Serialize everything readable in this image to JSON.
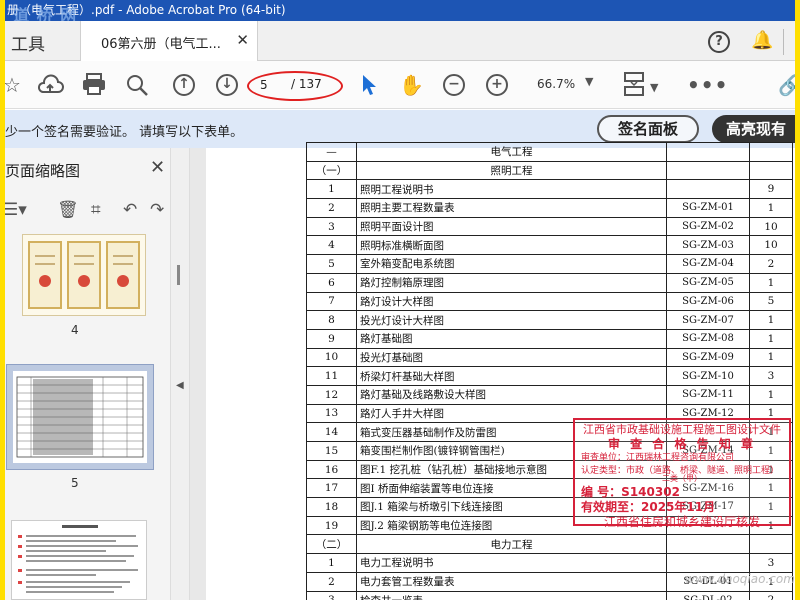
{
  "window": {
    "title": "册（电气工程）.pdf - Adobe Acrobat Pro (64-bit)",
    "watermark": "道 桥 网"
  },
  "tabbar": {
    "tools_label": "工具",
    "doc_tab_label": "06第六册（电气工...",
    "close_glyph": "✕"
  },
  "toolbar": {
    "current_page": "5",
    "total_pages": "/ 137",
    "zoom": "66.7%"
  },
  "signbar": {
    "message": "少一个签名需要验证。 请填写以下表单。",
    "sign_panel_label": "签名面板",
    "highlight_label": "高亮现有"
  },
  "leftpanel": {
    "title": "页面缩略图",
    "thumbnails": [
      {
        "label": "4"
      },
      {
        "label": "5"
      }
    ]
  },
  "document": {
    "header_partial": "电气工程",
    "sections": [
      {
        "marker": "（一）",
        "name": "照明工程",
        "rows": [
          {
            "no": "1",
            "name": "照明工程说明书",
            "code": "",
            "count": "9"
          },
          {
            "no": "2",
            "name": "照明主要工程数量表",
            "code": "SG-ZM-01",
            "count": "1"
          },
          {
            "no": "3",
            "name": "照明平面设计图",
            "code": "SG-ZM-02",
            "count": "10"
          },
          {
            "no": "4",
            "name": "照明标准横断面图",
            "code": "SG-ZM-03",
            "count": "10"
          },
          {
            "no": "5",
            "name": "室外箱变配电系统图",
            "code": "SG-ZM-04",
            "count": "2"
          },
          {
            "no": "6",
            "name": "路灯控制箱原理图",
            "code": "SG-ZM-05",
            "count": "1"
          },
          {
            "no": "7",
            "name": "路灯设计大样图",
            "code": "SG-ZM-06",
            "count": "5"
          },
          {
            "no": "8",
            "name": "投光灯设计大样图",
            "code": "SG-ZM-07",
            "count": "1"
          },
          {
            "no": "9",
            "name": "路灯基础图",
            "code": "SG-ZM-08",
            "count": "1"
          },
          {
            "no": "10",
            "name": "投光灯基础图",
            "code": "SG-ZM-09",
            "count": "1"
          },
          {
            "no": "11",
            "name": "桥梁灯杆基础大样图",
            "code": "SG-ZM-10",
            "count": "3"
          },
          {
            "no": "12",
            "name": "路灯基础及线路敷设大样图",
            "code": "SG-ZM-11",
            "count": "1"
          },
          {
            "no": "13",
            "name": "路灯人手井大样图",
            "code": "SG-ZM-12",
            "count": "1"
          },
          {
            "no": "14",
            "name": "箱式变压器基础制作及防雷图",
            "code": "",
            "count": "1"
          },
          {
            "no": "15",
            "name": "箱变围栏制作图(镀锌钢管围栏)",
            "code": "SG-ZM-14",
            "count": "1"
          },
          {
            "no": "16",
            "name": "图F.1 挖孔桩（钻孔桩）基础接地示意图",
            "code": "",
            "count": "1"
          },
          {
            "no": "17",
            "name": "图I 桥面伸缩装置等电位连接",
            "code": "SG-ZM-16",
            "count": "1"
          },
          {
            "no": "18",
            "name": "图J.1 箱梁与桥墩引下线连接图",
            "code": "SG-ZM-17",
            "count": "1"
          },
          {
            "no": "19",
            "name": "图J.2 箱梁钢筋等电位连接图",
            "code": "",
            "count": "1"
          }
        ]
      },
      {
        "marker": "（二）",
        "name": "电力工程",
        "rows": [
          {
            "no": "1",
            "name": "电力工程说明书",
            "code": "",
            "count": "3"
          },
          {
            "no": "2",
            "name": "电力套管工程数量表",
            "code": "SG-DL-01",
            "count": "1"
          },
          {
            "no": "3",
            "name": "检查井一览表",
            "code": "SG-DL-02",
            "count": "2"
          }
        ]
      }
    ],
    "stamp": {
      "line1": "江西省市政基础设施工程施工图设计文件",
      "line2": "审 查 合 格 告 知 章",
      "line3": "审查单位：江西瑞林工程咨询有限公司",
      "line4": "认定类型：市政（道路、桥梁、隧道、照明工程）",
      "line5": "二类（甲）",
      "line6": "编 号：S140302",
      "line7": "有效期至：2025年11月",
      "line8": "江西省住房和城乡建设厅核发"
    },
    "site_watermark": "www.daoqiao.com"
  }
}
